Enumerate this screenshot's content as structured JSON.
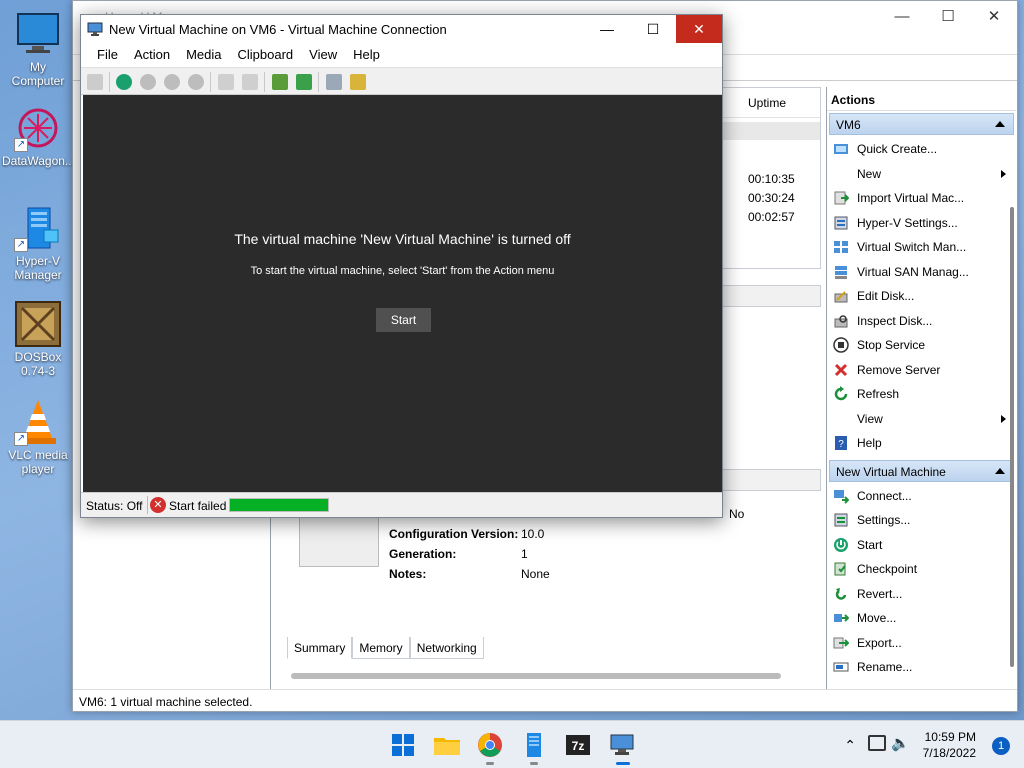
{
  "desktop": {
    "icons": [
      {
        "label": "My Computer",
        "icon": "monitor-icon"
      },
      {
        "label": "DataWagon...",
        "icon": "datawagon-icon"
      },
      {
        "label": "Hyper-V Manager",
        "icon": "hyperv-icon"
      },
      {
        "label": "DOSBox 0.74-3",
        "icon": "dosbox-icon"
      },
      {
        "label": "VLC media player",
        "icon": "vlc-cone-icon"
      }
    ]
  },
  "hyperv_manager": {
    "title": "Hyper-V Manager",
    "vm_list": {
      "uptime_header": "Uptime",
      "uptimes": [
        "00:10:35",
        "00:30:24",
        "00:02:57"
      ]
    },
    "details": {
      "heartbeat_value": "No",
      "rows": [
        {
          "key": "Configuration Version:",
          "value": "10.0"
        },
        {
          "key": "Generation:",
          "value": "1"
        },
        {
          "key": "Notes:",
          "value": "None"
        }
      ],
      "tabs": [
        "Summary",
        "Memory",
        "Networking"
      ]
    },
    "status_bar": "VM6:  1 virtual machine selected.",
    "actions": {
      "title": "Actions",
      "server_section": "VM6",
      "server_items": [
        {
          "label": "Quick Create...",
          "icon": "quick-create-icon",
          "submenu": false
        },
        {
          "label": "New",
          "icon": "",
          "submenu": true
        },
        {
          "label": "Import Virtual Mac...",
          "icon": "import-icon",
          "submenu": false
        },
        {
          "label": "Hyper-V Settings...",
          "icon": "settings-icon",
          "submenu": false
        },
        {
          "label": "Virtual Switch Man...",
          "icon": "switch-icon",
          "submenu": false
        },
        {
          "label": "Virtual SAN Manag...",
          "icon": "san-icon",
          "submenu": false
        },
        {
          "label": "Edit Disk...",
          "icon": "edit-disk-icon",
          "submenu": false
        },
        {
          "label": "Inspect Disk...",
          "icon": "inspect-disk-icon",
          "submenu": false
        },
        {
          "label": "Stop Service",
          "icon": "stop-icon",
          "submenu": false
        },
        {
          "label": "Remove Server",
          "icon": "remove-x-icon",
          "submenu": false
        },
        {
          "label": "Refresh",
          "icon": "refresh-icon",
          "submenu": false
        },
        {
          "label": "View",
          "icon": "",
          "submenu": true
        },
        {
          "label": "Help",
          "icon": "help-icon",
          "submenu": false
        }
      ],
      "vm_section": "New Virtual Machine",
      "vm_items": [
        {
          "label": "Connect...",
          "icon": "connect-icon"
        },
        {
          "label": "Settings...",
          "icon": "vm-settings-icon"
        },
        {
          "label": "Start",
          "icon": "power-icon"
        },
        {
          "label": "Checkpoint",
          "icon": "checkpoint-icon"
        },
        {
          "label": "Revert...",
          "icon": "revert-icon"
        },
        {
          "label": "Move...",
          "icon": "move-icon"
        },
        {
          "label": "Export...",
          "icon": "export-icon"
        },
        {
          "label": "Rename...",
          "icon": "rename-icon"
        }
      ]
    }
  },
  "vm_connection": {
    "title": "New Virtual Machine on VM6 - Virtual Machine Connection",
    "menu": [
      "File",
      "Action",
      "Media",
      "Clipboard",
      "View",
      "Help"
    ],
    "screen": {
      "headline": "The virtual machine 'New Virtual Machine' is turned off",
      "instruction": "To start the virtual machine, select 'Start' from the Action menu",
      "start_button": "Start"
    },
    "status": {
      "status_text": "Status: Off",
      "error_text": "Start failed",
      "progress": 1.0,
      "progress_color": "#06b025"
    }
  },
  "taskbar": {
    "time": "10:59 PM",
    "date": "7/18/2022",
    "notification_count": "1"
  },
  "colors": {
    "close_button": "#c42b1c",
    "vm_screen": "#2b2b2b",
    "action_section": "#c6daf1"
  }
}
